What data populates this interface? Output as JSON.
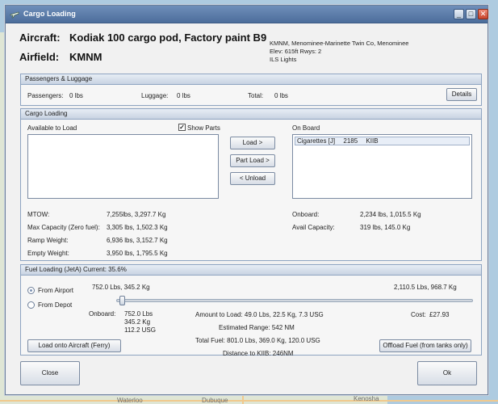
{
  "window": {
    "title": "Cargo Loading",
    "minimize_glyph": "_",
    "maximize_glyph": "□",
    "close_glyph": "✕"
  },
  "header": {
    "aircraft_label": "Aircraft:",
    "aircraft_value": "Kodiak 100 cargo pod, Factory paint B9",
    "airfield_label": "Airfield:",
    "airfield_value": "KMNM",
    "airport_info": [
      "KMNM, Menominee-Marinette Twin Co, Menominee",
      "Elev: 615ft Rwys: 2",
      "ILS Lights"
    ]
  },
  "passengers": {
    "title": "Passengers & Luggage",
    "passengers_label": "Passengers:",
    "passengers_value": "0 lbs",
    "luggage_label": "Luggage:",
    "luggage_value": "0 lbs",
    "total_label": "Total:",
    "total_value": "0 lbs",
    "details_button": "Details"
  },
  "cargo": {
    "title": "Cargo Loading",
    "available_label": "Available to Load",
    "show_parts_label": "Show Parts",
    "show_parts_checked": true,
    "load_button": "Load >",
    "part_load_button": "Part Load >",
    "unload_button": "< Unload",
    "onboard_label": "On Board",
    "onboard_items": [
      {
        "name": "Cigarettes [J]",
        "weight": "2185",
        "destination": "KIIB"
      }
    ],
    "stats_left": [
      {
        "label": "MTOW:",
        "value": "7,255lbs, 3,297.7 Kg"
      },
      {
        "label": "Max Capacity (Zero fuel):",
        "value": "3,305 lbs, 1,502.3 Kg"
      },
      {
        "label": "Ramp Weight:",
        "value": "6,936 lbs, 3,152.7 Kg"
      },
      {
        "label": "Empty Weight:",
        "value": "3,950 lbs, 1,795.5 Kg"
      }
    ],
    "stats_right": [
      {
        "label": "Onboard:",
        "value": "2,234 lbs, 1,015.5 Kg"
      },
      {
        "label": "Avail Capacity:",
        "value": "319 lbs, 145.0 Kg"
      }
    ]
  },
  "fuel": {
    "title": "Fuel Loading (JetA)  Current: 35.6%",
    "from_airport_label": "From Airport",
    "from_depot_label": "From Depot",
    "from_airport_selected": true,
    "slider_min_label": "752.0 Lbs, 345.2 Kg",
    "slider_max_label": "2,110.5 Lbs, 968.7 Kg",
    "slider_position": 0.0,
    "onboard_label": "Onboard:",
    "onboard_lines": [
      "752.0 Lbs",
      "345.2 Kg",
      "112.2 USG"
    ],
    "amount_to_load": "Amount to Load: 49.0 Lbs, 22.5 Kg, 7.3 USG",
    "estimated_range": "Estimated Range: 542 NM",
    "total_fuel": "Total Fuel: 801.0 Lbs, 369.0 Kg, 120.0 USG",
    "distance": "Distance to KIIB: 246NM",
    "cost_label": "Cost:",
    "cost_value": "£27.93",
    "ferry_button": "Load onto Aircraft (Ferry)",
    "offload_button": "Offload Fuel (from tanks only)"
  },
  "footer": {
    "close_button": "Close",
    "ok_button": "Ok"
  },
  "map_labels": {
    "bottom_left": "Waterloo",
    "bottom_mid": "Dubuque",
    "bottom_right": "Kenosha"
  },
  "colors": {
    "titlebar": "#4c6d9b",
    "window_bg": "#f1f1f1",
    "group_border": "#8ea4c1"
  }
}
